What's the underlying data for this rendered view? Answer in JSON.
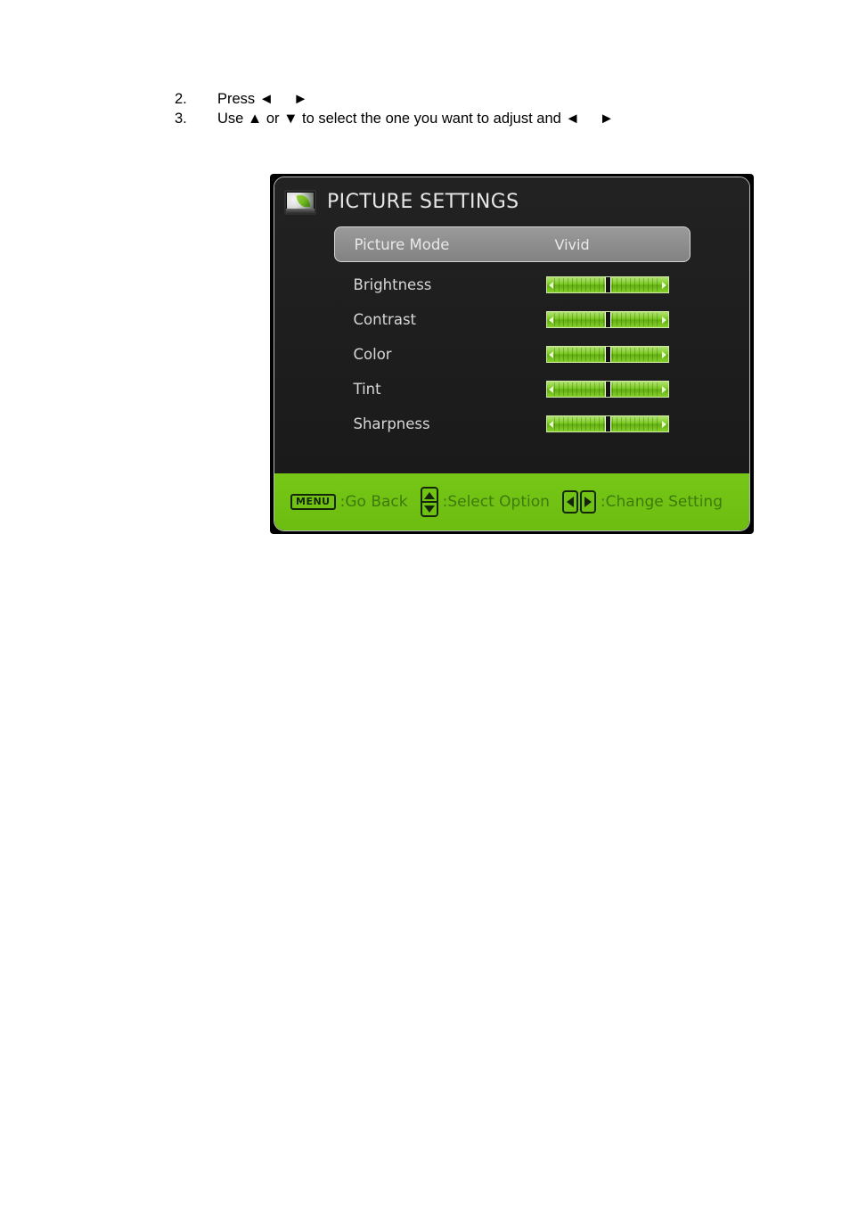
{
  "page": {
    "background_color": "#ffffff"
  },
  "instructions": [
    {
      "number": "2.",
      "text_before": "Press ",
      "arrow_left": "◄",
      "arrow_right": "►",
      "text_after": ""
    },
    {
      "number": "3.",
      "text_before": "Use ▲ or ▼ to select the one you want to adjust and ",
      "arrow_left": "◄",
      "arrow_right": "►",
      "text_after": ""
    }
  ],
  "osd": {
    "title": "PICTURE SETTINGS",
    "icon": "tv-leaf-icon",
    "colors": {
      "panel_background": "#1e1e1e",
      "panel_border": "#b9b9b9",
      "footer_green": "#6cbe12",
      "slider_green": "#78c81e",
      "selected_row_gray": "#8c8c8c",
      "title_text": "#e7e7e7",
      "label_text": "#d7d7d7",
      "footer_text": "#3f7a0c"
    },
    "rows": [
      {
        "label": "Picture Mode",
        "type": "option",
        "value": "Vivid",
        "selected": true
      },
      {
        "label": "Brightness",
        "type": "slider",
        "value_percent": 50,
        "selected": false
      },
      {
        "label": "Contrast",
        "type": "slider",
        "value_percent": 50,
        "selected": false
      },
      {
        "label": "Color",
        "type": "slider",
        "value_percent": 50,
        "selected": false
      },
      {
        "label": "Tint",
        "type": "slider",
        "value_percent": 50,
        "selected": false
      },
      {
        "label": "Sharpness",
        "type": "slider",
        "value_percent": 50,
        "selected": false
      }
    ],
    "footer": {
      "hints": [
        {
          "key_type": "menu-key",
          "key_label": "MENU",
          "text": ":Go Back"
        },
        {
          "key_type": "updown-key",
          "key_label": "",
          "text": ":Select Option"
        },
        {
          "key_type": "leftright-key",
          "key_label": "",
          "text": ":Change Setting"
        }
      ]
    }
  }
}
